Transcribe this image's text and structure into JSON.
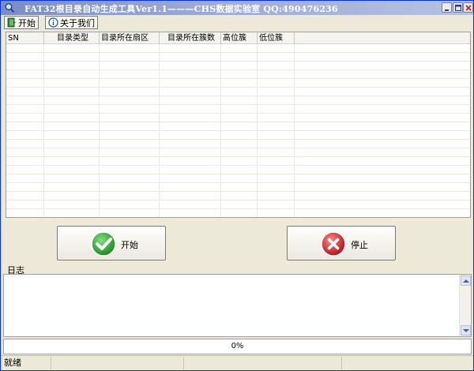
{
  "window": {
    "title": "FAT32根目录自动生成工具Ver1.1———CHS数据实验室 QQ:490476236",
    "icon": "magnifier-icon"
  },
  "toolbar": {
    "start_label": "开始",
    "about_label": "关于我们"
  },
  "table": {
    "columns": [
      "SN",
      "目录类型",
      "目录所在扇区",
      "目录所在簇数",
      "高位簇",
      "低位簇"
    ],
    "rows": []
  },
  "buttons": {
    "start_label": "开始",
    "stop_label": "停止"
  },
  "log": {
    "label": "日志",
    "text": ""
  },
  "progress": {
    "value": 0,
    "text": "0%"
  },
  "status": {
    "text": "就绪"
  },
  "colors": {
    "title_gradient_start": "#7a8cc4",
    "ok_green": "#2ea12e",
    "stop_red": "#c81e2a"
  }
}
